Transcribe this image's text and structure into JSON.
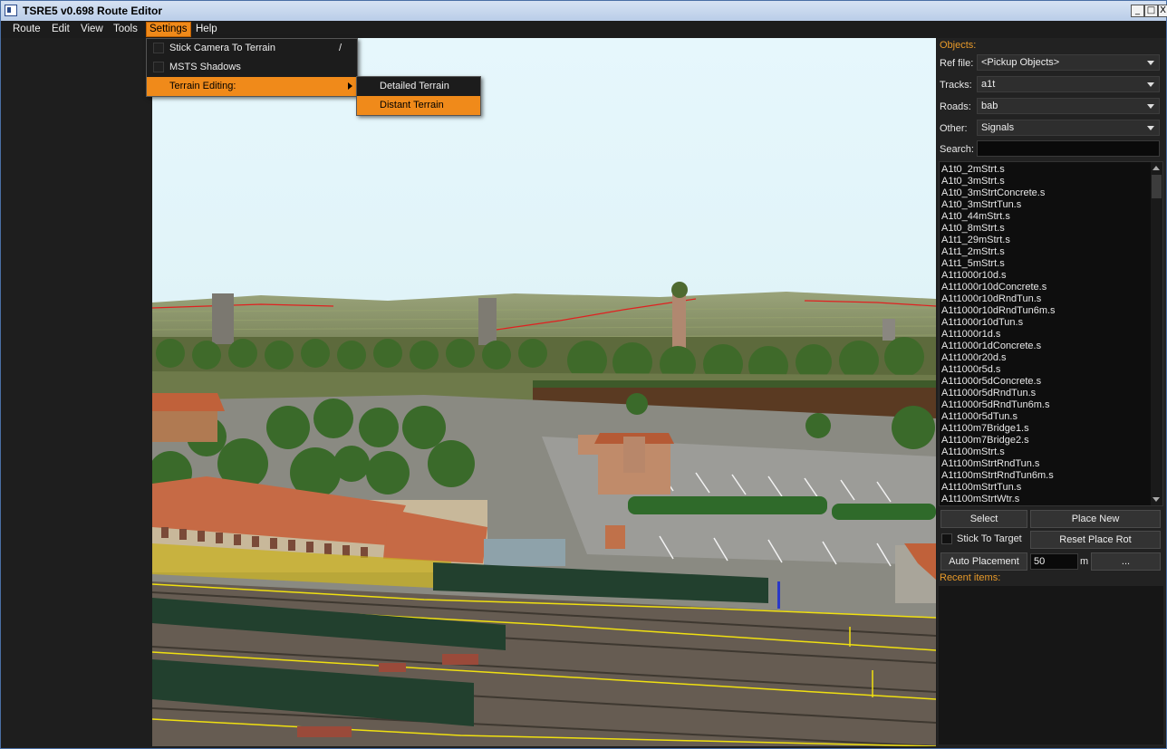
{
  "window": {
    "title": "TSRE5 v0.698 Route Editor"
  },
  "title_buttons": [
    "_",
    "□",
    "X"
  ],
  "menubar": [
    "Route",
    "Edit",
    "View",
    "Tools",
    "Settings",
    "Help"
  ],
  "settings_menu": {
    "stick_camera": "Stick Camera To Terrain",
    "stick_camera_shortcut": "/",
    "msts_shadows": "MSTS Shadows",
    "terrain_editing": "Terrain Editing:"
  },
  "terrain_submenu": {
    "detailed": "Detailed Terrain",
    "distant": "Distant Terrain"
  },
  "objects_panel": {
    "header": "Objects:",
    "ref_file_label": "Ref file:",
    "ref_file_value": "<Pickup Objects>",
    "tracks_label": "Tracks:",
    "tracks_value": "a1t",
    "roads_label": "Roads:",
    "roads_value": "bab",
    "other_label": "Other:",
    "other_value": "Signals",
    "search_label": "Search:",
    "search_value": "",
    "items": [
      "A1t0_2mStrt.s",
      "A1t0_3mStrt.s",
      "A1t0_3mStrtConcrete.s",
      "A1t0_3mStrtTun.s",
      "A1t0_44mStrt.s",
      "A1t0_8mStrt.s",
      "A1t1_29mStrt.s",
      "A1t1_2mStrt.s",
      "A1t1_5mStrt.s",
      "A1t1000r10d.s",
      "A1t1000r10dConcrete.s",
      "A1t1000r10dRndTun.s",
      "A1t1000r10dRndTun6m.s",
      "A1t1000r10dTun.s",
      "A1t1000r1d.s",
      "A1t1000r1dConcrete.s",
      "A1t1000r20d.s",
      "A1t1000r5d.s",
      "A1t1000r5dConcrete.s",
      "A1t1000r5dRndTun.s",
      "A1t1000r5dRndTun6m.s",
      "A1t1000r5dTun.s",
      "A1t100m7Bridge1.s",
      "A1t100m7Bridge2.s",
      "A1t100mStrt.s",
      "A1t100mStrtRndTun.s",
      "A1t100mStrtRndTun6m.s",
      "A1t100mStrtTun.s",
      "A1t100mStrtWtr.s"
    ],
    "select_btn": "Select",
    "place_new_btn": "Place New",
    "stick_to_target": "Stick To Target",
    "reset_place_rot": "Reset Place Rot",
    "auto_placement": "Auto Placement",
    "auto_placement_value": "50",
    "auto_placement_unit": "m",
    "more_btn": "...",
    "recent_header": "Recent items:"
  },
  "colors": {
    "accent": "#f08a1a",
    "panel": "#1e1e1e",
    "section_label": "#e89a2a",
    "sky": "#e4f5fb"
  }
}
